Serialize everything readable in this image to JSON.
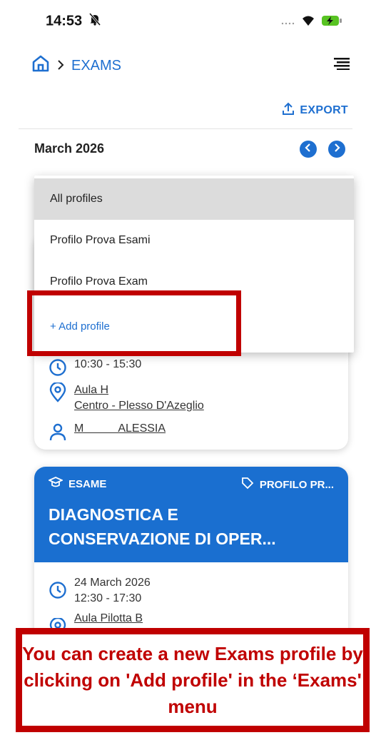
{
  "status": {
    "time": "14:53"
  },
  "header": {
    "breadcrumb": "EXAMS",
    "export_label": "EXPORT"
  },
  "calendar": {
    "month_label": "March 2026"
  },
  "dropdown": {
    "items": [
      {
        "label": "All profiles"
      },
      {
        "label": "Profilo Prova Esami"
      },
      {
        "label": "Profilo Prova Exam"
      }
    ],
    "add_label": "+ Add profile"
  },
  "card1": {
    "time": "10:30 - 15:30",
    "room": "Aula H",
    "location": "Centro - Plesso D'Azeglio",
    "person": "M           ALESSIA"
  },
  "card2": {
    "type": "ESAME",
    "profile": "PROFILO PR...",
    "title_line1": "DIAGNOSTICA E",
    "title_line2": "CONSERVAZIONE DI OPER...",
    "date": "24 March 2026",
    "time": "12:30 - 17:30",
    "room": "Aula Pilotta B"
  },
  "callout": {
    "text": "You can create a new Exams profile by clicking on 'Add profile' in the ‘Exams' menu"
  },
  "colors": {
    "accent": "#1e6fd0",
    "callout_red": "#c00000"
  }
}
